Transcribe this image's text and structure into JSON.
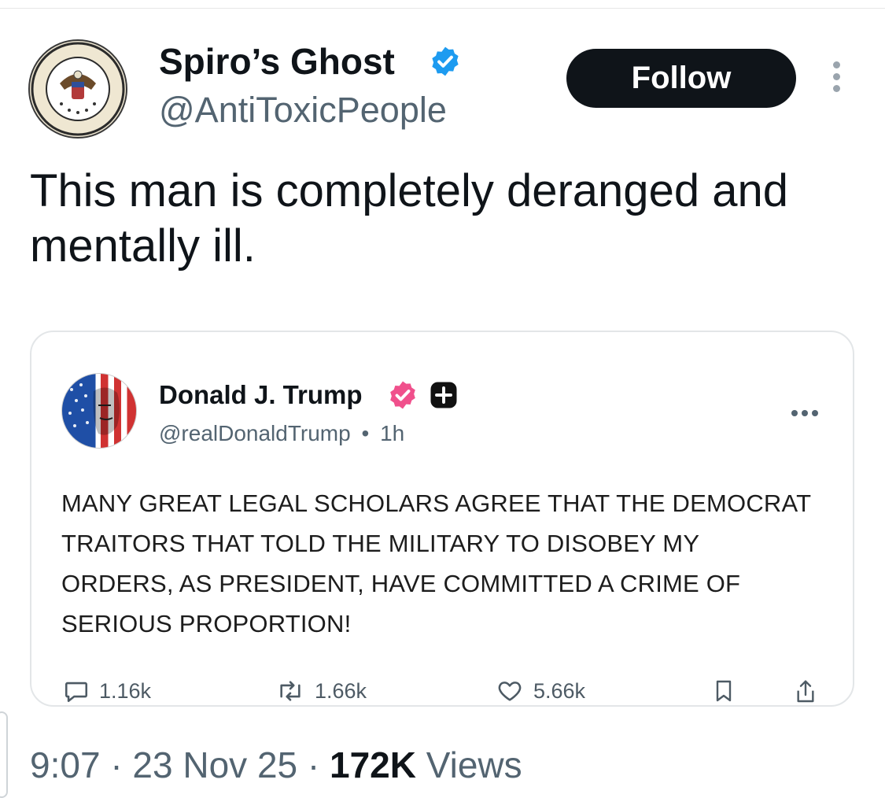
{
  "author": {
    "display_name": "Spiro’s Ghost",
    "handle": "@AntiToxicPeople",
    "avatar": "vice-president-seal-avatar",
    "verified_color": "#1d9bf0"
  },
  "follow_button": {
    "label": "Follow"
  },
  "tweet": {
    "text": "This man is completely deranged and mentally ill."
  },
  "quoted_post": {
    "display_name": "Donald J. Trump",
    "handle": "@realDonaldTrump",
    "separator": "•",
    "time": "1h",
    "avatar": "flag-portrait-avatar",
    "badge_color": "#f0508c",
    "text": "MANY GREAT LEGAL SCHOLARS AGREE THAT THE DEMOCRAT TRAITORS THAT TOLD THE MILITARY TO DISOBEY MY ORDERS, AS PRESIDENT, HAVE COMMITTED A CRIME OF SERIOUS PROPORTION!",
    "stats": {
      "replies": "1.16k",
      "reposts": "1.66k",
      "likes": "5.66k"
    }
  },
  "meta": {
    "time": "9:07",
    "sep1": "·",
    "date": "23 Nov 25",
    "sep2": "·",
    "views_count": "172K",
    "views_label": "Views"
  }
}
